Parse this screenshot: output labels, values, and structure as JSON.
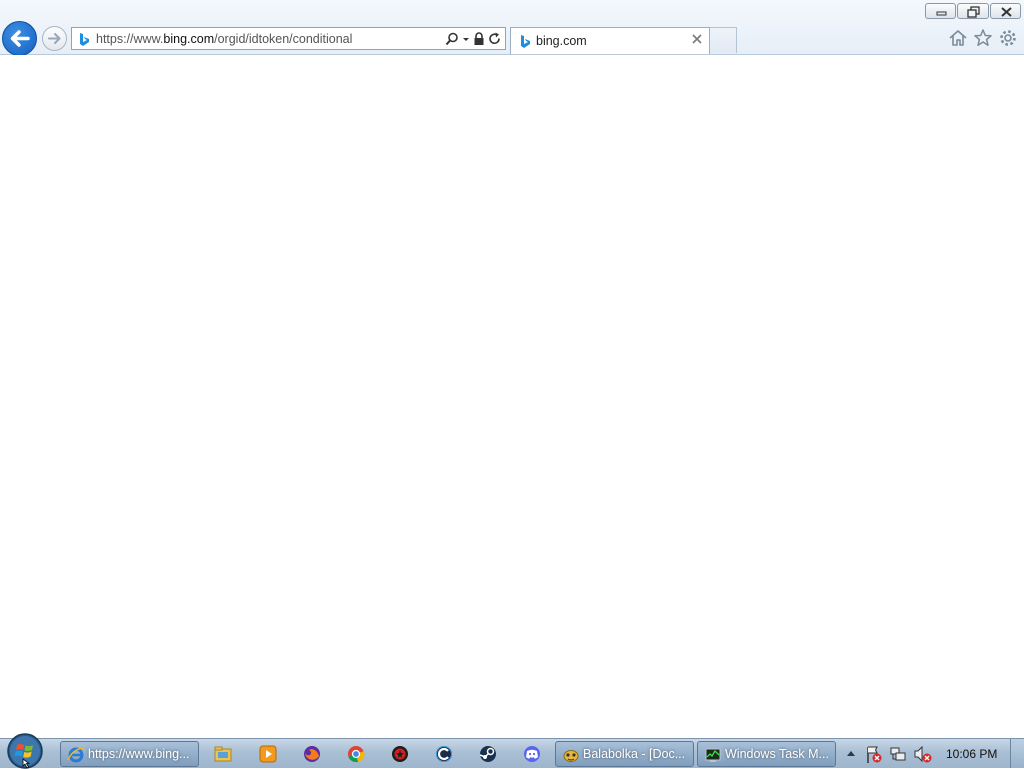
{
  "window": {
    "minimize_icon": "minimize-icon",
    "restore_icon": "restore-icon",
    "close_icon": "close-icon"
  },
  "nav": {
    "back_icon": "back-arrow-icon",
    "forward_icon": "forward-arrow-icon"
  },
  "address_bar": {
    "url_prefix": "https://www.",
    "url_domain": "bing.com",
    "url_path": "/orgid/idtoken/conditional",
    "favicon": "bing-icon",
    "search_icon": "search-icon",
    "dropdown_icon": "dropdown-arrow-icon",
    "lock_icon": "lock-icon",
    "refresh_icon": "refresh-icon"
  },
  "tabs": [
    {
      "label": "bing.com",
      "favicon": "bing-icon",
      "active": true
    }
  ],
  "toolbar": {
    "home_icon": "home-icon",
    "favorites_icon": "star-icon",
    "tools_icon": "gear-icon"
  },
  "taskbar": {
    "start": "windows-start-orb",
    "buttons": [
      {
        "label": "https://www.bing...",
        "icon": "internet-explorer-icon"
      },
      {
        "label": "Balabolka - [Doc...",
        "icon": "balabolka-icon"
      },
      {
        "label": "Windows Task M...",
        "icon": "task-manager-icon"
      }
    ],
    "pinned": [
      "file-explorer-icon",
      "media-player-icon",
      "firefox-icon",
      "chrome-icon",
      "app-red-icon",
      "ccleaner-icon",
      "steam-icon",
      "discord-icon"
    ],
    "tray_icons": [
      "show-hidden-icons-arrow",
      "action-center-icon",
      "network-icon",
      "volume-muted-icon"
    ],
    "clock": "10:06 PM"
  },
  "colors": {
    "ie_blue": "#1a6fd0",
    "bing_blue": "#1e8fe0",
    "taskbar": "#a9bfd4"
  }
}
